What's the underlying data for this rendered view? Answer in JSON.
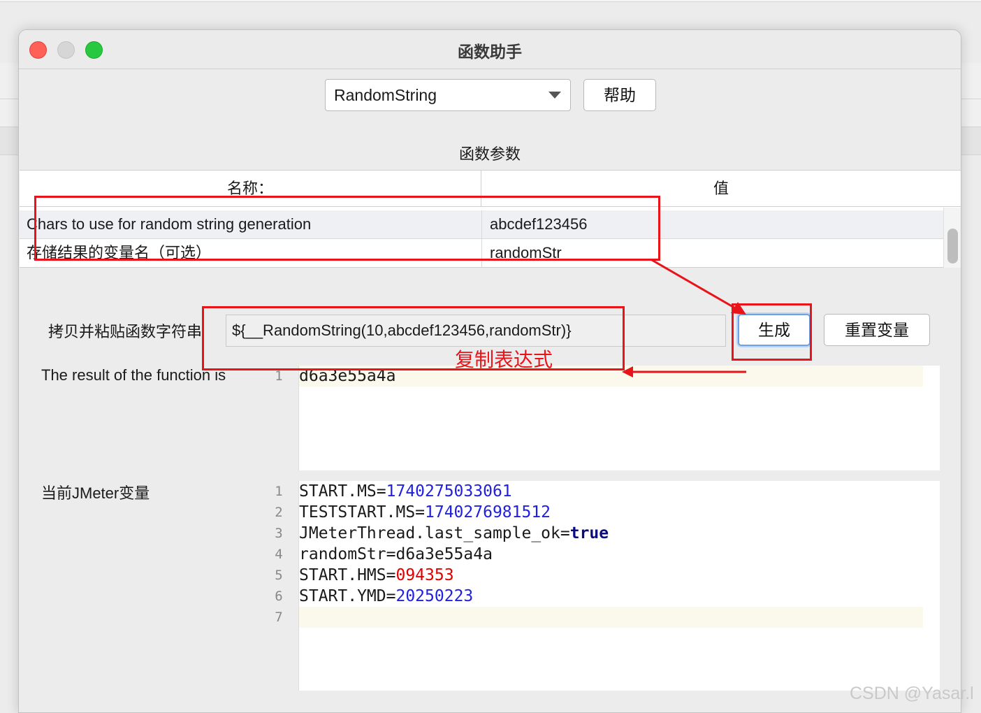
{
  "window": {
    "title": "函数助手"
  },
  "toolbar": {
    "function_select_value": "RandomString",
    "help_label": "帮助"
  },
  "params": {
    "section_title": "函数参数",
    "col_name": "名称：",
    "col_value": "值",
    "rows": [
      {
        "name": "Chars to use for random string generation",
        "value": "abcdef123456"
      },
      {
        "name": "存储结果的变量名（可选）",
        "value": "randomStr"
      }
    ]
  },
  "copy": {
    "label": "拷贝并粘贴函数字符串",
    "value": "${__RandomString(10,abcdef123456,randomStr)}",
    "generate_label": "生成",
    "reset_label": "重置变量"
  },
  "result": {
    "label": "The result of the function is",
    "line_numbers": [
      "1"
    ],
    "lines": [
      "d6a3e55a4a"
    ]
  },
  "variables": {
    "label": "当前JMeter变量",
    "line_numbers": [
      "1",
      "2",
      "3",
      "4",
      "5",
      "6",
      "7"
    ],
    "lines": [
      {
        "key": "START.MS=",
        "val": "1740275033061",
        "kind": "number"
      },
      {
        "key": "TESTSTART.MS=",
        "val": "1740276981512",
        "kind": "number"
      },
      {
        "key": "JMeterThread.last_sample_ok=",
        "val": "true",
        "kind": "keyword"
      },
      {
        "key": "randomStr=d6a3e55a4a",
        "val": "",
        "kind": "plain"
      },
      {
        "key": "START.HMS=",
        "val": "094353",
        "kind": "string"
      },
      {
        "key": "START.YMD=",
        "val": "20250223",
        "kind": "number"
      },
      {
        "key": "",
        "val": "",
        "kind": "plain"
      }
    ]
  },
  "annotation": {
    "text": "复制表达式"
  },
  "colors": {
    "annotation_red": "#e8141a",
    "number_blue": "#2020e0",
    "string_red": "#e00000",
    "keyword_navy": "#0b0b80"
  },
  "watermark": "CSDN @Yasar.l"
}
